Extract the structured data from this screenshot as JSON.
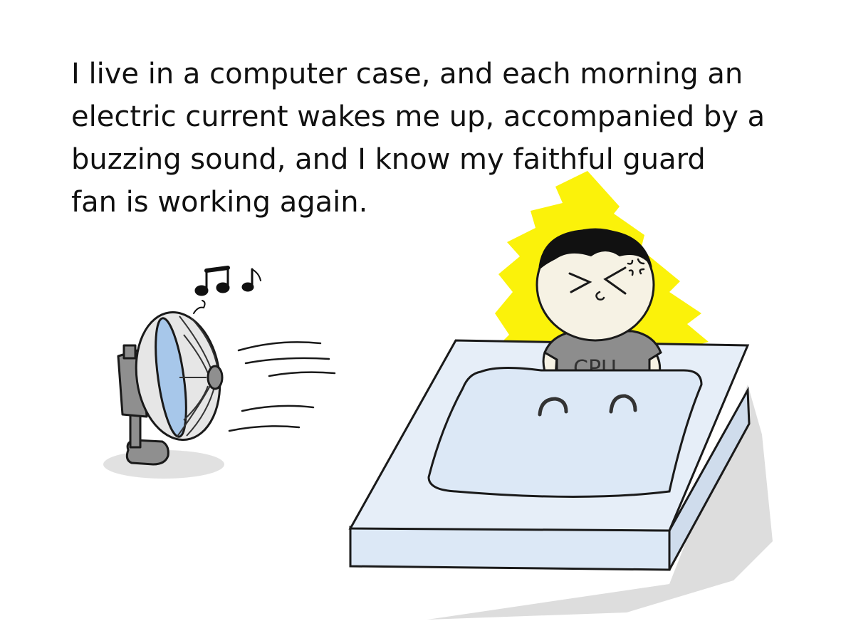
{
  "caption": {
    "lines": [
      "I live in a computer case, and each morning an",
      "electric current wakes me up, accompanied by a",
      "buzzing sound, and I know my faithful guard",
      "fan is working again."
    ]
  },
  "illustration": {
    "shirt_label": "CPU",
    "music_notes": "♫ ♪",
    "colors": {
      "glow": "#fbf20a",
      "face": "#f6f2e4",
      "hair": "#111111",
      "shirt": "#8d8d8d",
      "blanket": "#dce8f6",
      "bed": "#e6eef8",
      "shadow": "#dedede",
      "fan_body": "#8f8f8f"
    },
    "icons": [
      "desk-fan-icon",
      "music-notes-icon",
      "anger-mark-icon",
      "wind-lines-icon"
    ]
  }
}
